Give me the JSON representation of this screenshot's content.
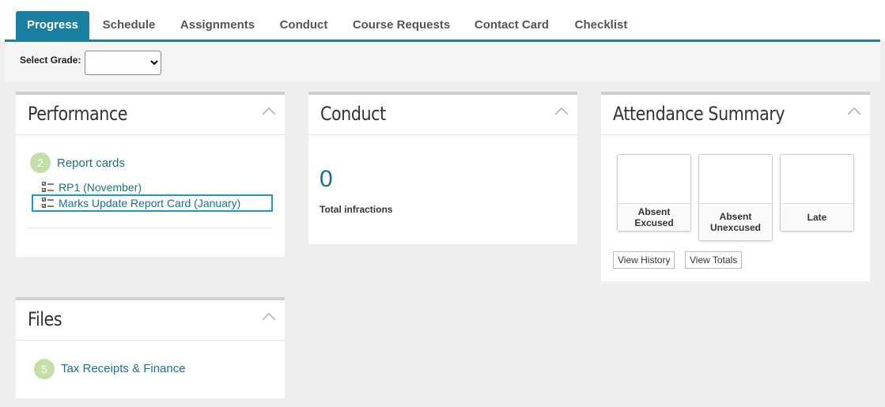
{
  "tabs": [
    {
      "label": "Progress"
    },
    {
      "label": "Schedule"
    },
    {
      "label": "Assignments"
    },
    {
      "label": "Conduct"
    },
    {
      "label": "Course Requests"
    },
    {
      "label": "Contact Card"
    },
    {
      "label": "Checklist"
    }
  ],
  "active_tab": "Progress",
  "grade": {
    "label": "Select Grade:",
    "value": ""
  },
  "performance": {
    "title": "Performance",
    "report_count": "2",
    "report_label": "Report cards",
    "reports": [
      {
        "label": "RP1 (November)"
      },
      {
        "label": "Marks Update Report Card (January)"
      }
    ]
  },
  "conduct": {
    "title": "Conduct",
    "count": "0",
    "caption": "Total infractions"
  },
  "attendance": {
    "title": "Attendance Summary",
    "cards": [
      {
        "label": "Absent Excused"
      },
      {
        "label": "Absent Unexcused"
      },
      {
        "label": "Late"
      }
    ],
    "view_history": "View History",
    "view_totals": "View Totals"
  },
  "files": {
    "title": "Files",
    "count": "5",
    "label": "Tax Receipts & Finance"
  },
  "colors": {
    "accent": "#1a7fa0",
    "link": "#1a6f92",
    "badge": "#c3dfa6",
    "focus": "#1e96d1"
  },
  "icons": {
    "collapse": "chevron-up-icon",
    "report": "checklist-icon",
    "select": "chevron-down-icon"
  }
}
